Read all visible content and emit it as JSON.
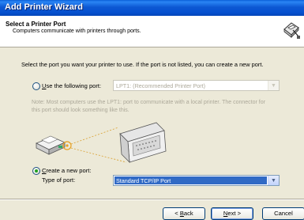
{
  "window": {
    "title": "Add Printer Wizard"
  },
  "header": {
    "title": "Select a Printer Port",
    "subtitle": "Computers communicate with printers through ports.",
    "icon": "printer-port-wizard-icon"
  },
  "body": {
    "instruction": "Select the port you want your printer to use.  If the port is not listed, you can create a new port.",
    "use_existing": {
      "label_prefix": "",
      "label_accel": "U",
      "label_rest": "se the following port:",
      "selected": false,
      "port_value": "LPT1: (Recommended Printer Port)"
    },
    "note": "Note: Most computers use the LPT1: port to communicate with a local printer. The connector for this port should look something like this.",
    "create_new": {
      "label_accel": "C",
      "label_rest": "reate a new port:",
      "selected": true,
      "type_label": "Type of port:",
      "type_value": "Standard TCP/IP Port"
    }
  },
  "buttons": {
    "back_accel": "B",
    "back_rest": "ack",
    "back_prefix": "< ",
    "next_accel": "N",
    "next_rest": "ext >",
    "cancel": "Cancel"
  },
  "colors": {
    "titlebar": "#0550cf",
    "selection": "#316ac5",
    "radio_dot": "#21a121"
  }
}
